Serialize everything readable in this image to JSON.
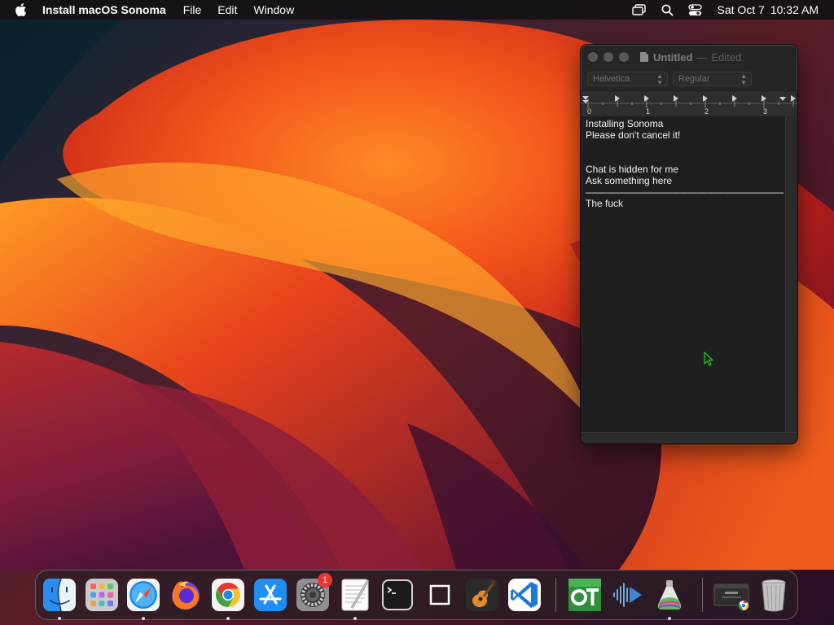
{
  "menubar": {
    "app_name": "Install macOS Sonoma",
    "menus": [
      "File",
      "Edit",
      "Window"
    ],
    "clock_day": "Sat Oct 7",
    "clock_time": "10:32 AM",
    "status_icons": [
      "screen-mirroring-icon",
      "spotlight-search-icon",
      "control-center-icon"
    ]
  },
  "textedit": {
    "title": "Untitled",
    "separator": "—",
    "edited": "Edited",
    "font_family": "Helvetica",
    "font_style": "Regular",
    "ruler_labels": [
      "0",
      "1",
      "2",
      "3"
    ],
    "document_lines": [
      "Installing Sonoma",
      "Please don't cancel it!",
      "",
      "",
      "Chat is hidden for me",
      "Ask something here",
      "——————————————————————",
      "The fuck"
    ]
  },
  "dock": {
    "items": [
      {
        "name": "Finder",
        "icon": "finder-icon",
        "running": true
      },
      {
        "name": "Launchpad",
        "icon": "launchpad-icon",
        "running": false
      },
      {
        "name": "Safari",
        "icon": "safari-icon",
        "running": true
      },
      {
        "name": "Firefox",
        "icon": "firefox-icon",
        "running": false
      },
      {
        "name": "Google Chrome",
        "icon": "chrome-icon",
        "running": true
      },
      {
        "name": "App Store",
        "icon": "app-store-icon",
        "running": false
      },
      {
        "name": "System Settings",
        "icon": "system-settings-icon",
        "running": false,
        "badge": "1"
      },
      {
        "name": "TextEdit",
        "icon": "textedit-icon",
        "running": true
      },
      {
        "name": "Terminal",
        "icon": "terminal-icon",
        "running": false
      },
      {
        "name": "Blank App",
        "icon": "blank-square-icon",
        "running": false
      },
      {
        "name": "GarageBand",
        "icon": "garageband-icon",
        "running": false
      },
      {
        "name": "Visual Studio Code",
        "icon": "vscode-icon",
        "running": false
      },
      {
        "name": "OT App",
        "icon": "ot-icon",
        "running": false
      },
      {
        "name": "Media Player",
        "icon": "media-player-icon",
        "running": false
      },
      {
        "name": "Install macOS Sonoma",
        "icon": "install-sonoma-icon",
        "running": true
      },
      {
        "name": "Recent Window",
        "icon": "recent-window-icon",
        "running": false
      },
      {
        "name": "Trash",
        "icon": "trash-icon",
        "running": false
      }
    ]
  },
  "colors": {
    "menubar_bg": "#161214",
    "window_bg": "#262626",
    "document_bg": "#1f1f1f",
    "badge_red": "#e8352c",
    "cursor_green": "#22c01c"
  }
}
